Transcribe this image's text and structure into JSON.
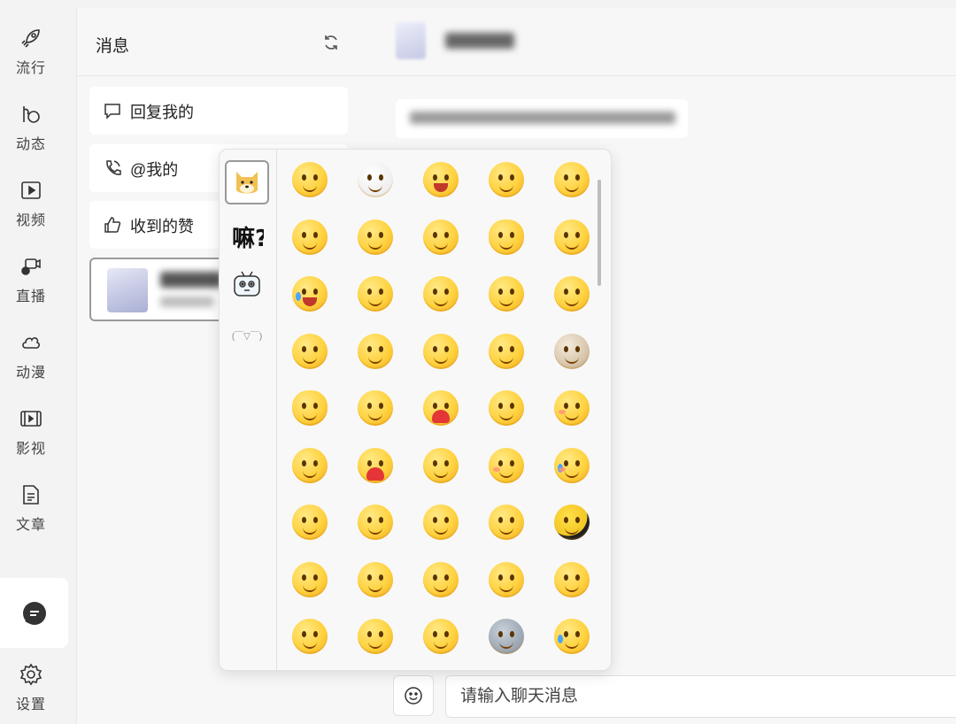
{
  "nav": {
    "items": [
      {
        "label": "流行",
        "icon": "rocket-icon"
      },
      {
        "label": "动态",
        "icon": "dynamics-icon"
      },
      {
        "label": "视频",
        "icon": "video-play-icon"
      },
      {
        "label": "直播",
        "icon": "live-camera-icon"
      },
      {
        "label": "动漫",
        "icon": "anime-cloud-icon"
      },
      {
        "label": "影视",
        "icon": "film-icon"
      },
      {
        "label": "文章",
        "icon": "article-icon"
      }
    ],
    "active_icon": "chat-bubble-icon",
    "settings_label": "设置"
  },
  "messages": {
    "title": "消息",
    "refresh_icon": "refresh-icon",
    "categories": [
      {
        "label": "回复我的",
        "icon": "reply-bubble-icon"
      },
      {
        "label": "@我的",
        "icon": "at-phone-icon"
      },
      {
        "label": "收到的赞",
        "icon": "thumbs-up-icon"
      }
    ]
  },
  "emoji_panel": {
    "packages": [
      {
        "name": "doge-package-icon"
      },
      {
        "name": "text-package-icon",
        "text": "嘛?"
      },
      {
        "name": "tv-package-icon"
      },
      {
        "name": "kaomoji-package-icon",
        "text": "(￣▽￣)"
      }
    ],
    "emoji_count": 45
  },
  "chat": {
    "input_placeholder": "请输入聊天消息",
    "emoji_button_icon": "smile-icon"
  },
  "colors": {
    "background": "#f3f3f3",
    "panel": "#f7f7f7",
    "card": "#ffffff",
    "emoji_yellow": "#ffd23f"
  }
}
